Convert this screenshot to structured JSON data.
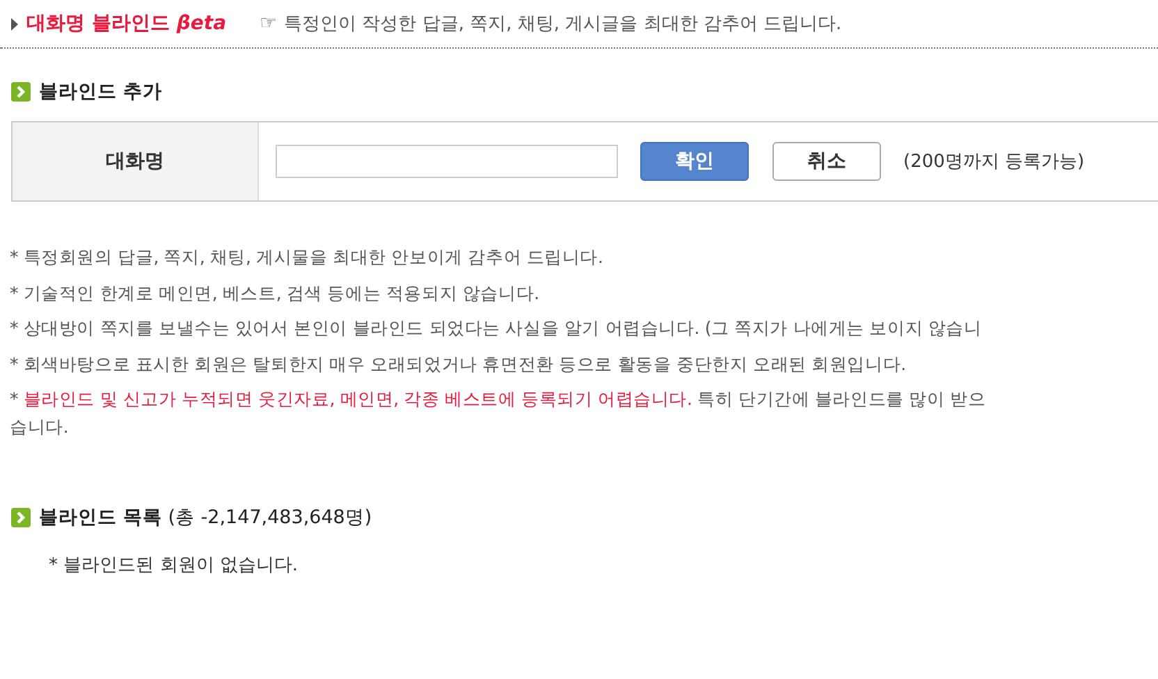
{
  "header": {
    "title": "대화명 블라인드",
    "beta": "βeta",
    "hint_icon": "☞",
    "hint": "특정인이 작성한 답글, 쪽지, 채팅, 게시글을 최대한 감추어 드립니다."
  },
  "add_section": {
    "title": "블라인드 추가",
    "field_label": "대화명",
    "confirm_button": "확인",
    "cancel_button": "취소",
    "limit_note": "(200명까지 등록가능)"
  },
  "notes": [
    {
      "segments": [
        {
          "text": "* 특정회원의 답글, 쪽지, 채팅, 게시물을 최대한 안보이게 감추어 드립니다.",
          "highlight": false
        }
      ]
    },
    {
      "segments": [
        {
          "text": "* 기술적인 한계로 메인면, 베스트, 검색 등에는 적용되지 않습니다.",
          "highlight": false
        }
      ]
    },
    {
      "segments": [
        {
          "text": "* 상대방이 쪽지를 보낼수는 있어서 본인이 블라인드 되었다는 사실을 알기 어렵습니다. (그 쪽지가 나에게는 보이지 않습니",
          "highlight": false
        }
      ]
    },
    {
      "segments": [
        {
          "text": "* 회색바탕으로 표시한 회원은 탈퇴한지 매우 오래되었거나 휴면전환 등으로 활동을 중단한지 오래된 회원입니다.",
          "highlight": false
        }
      ]
    },
    {
      "segments": [
        {
          "text": "* ",
          "highlight": false
        },
        {
          "text": "블라인드 및 신고가 누적되면 웃긴자료, 메인면, 각종 베스트에 등록되기 어렵습니다.",
          "highlight": true
        },
        {
          "text": " 특히 단기간에 블라인드를 많이 받으",
          "highlight": false
        }
      ],
      "second_line": "습니다."
    }
  ],
  "list_section": {
    "title": "블라인드 목록",
    "count": "(총 -2,147,483,648명)",
    "empty_message": "* 블라인드된 회원이 없습니다."
  }
}
